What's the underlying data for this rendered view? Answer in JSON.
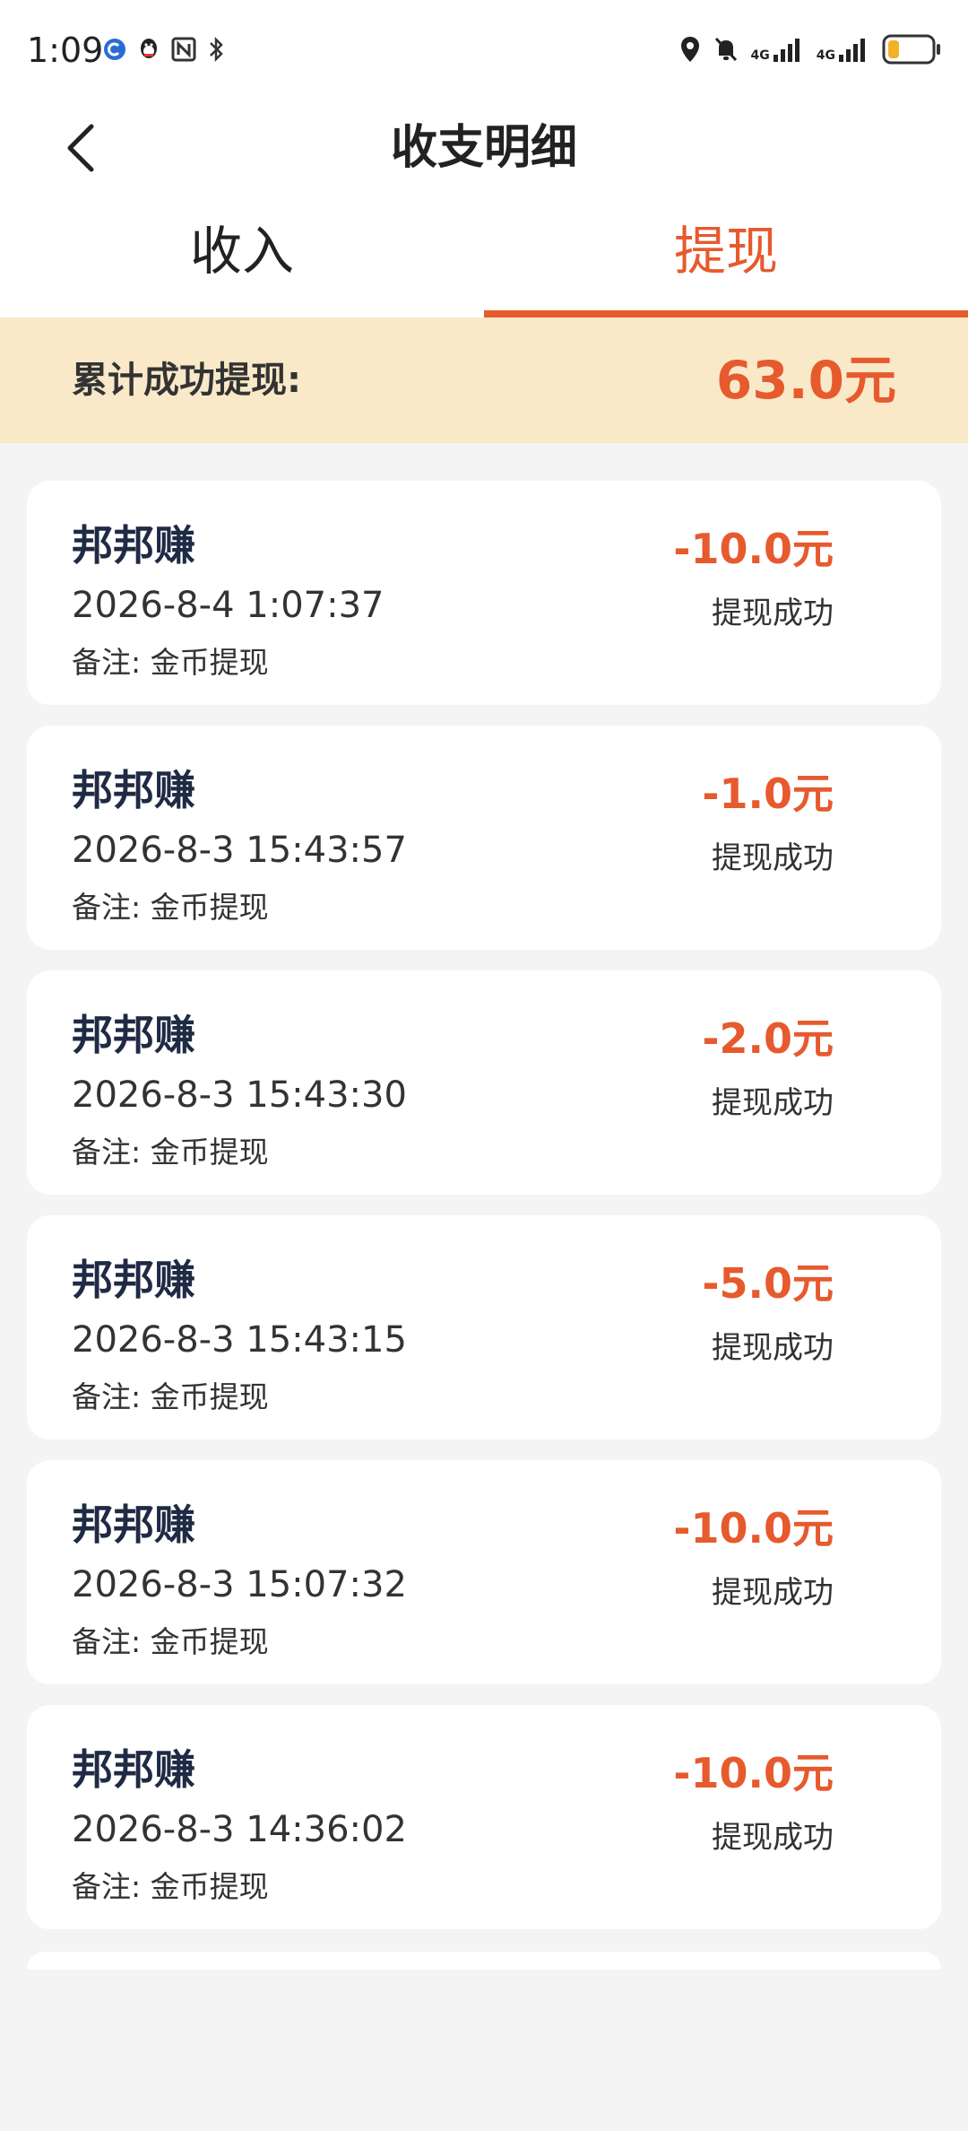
{
  "status_bar": {
    "time": "1:09",
    "left_icons": [
      "app-notification-icon",
      "qq-icon",
      "nfc-icon",
      "bluetooth-icon"
    ],
    "right_icons": [
      "location-icon",
      "mute-bell-icon",
      "signal-4g-icon",
      "signal-4g-icon",
      "battery-low-icon"
    ],
    "network_label_1": "4G",
    "network_label_2": "4G"
  },
  "header": {
    "title": "收支明细"
  },
  "tabs": [
    {
      "label": "收入",
      "active": false
    },
    {
      "label": "提现",
      "active": true
    }
  ],
  "summary": {
    "label": "累计成功提现:",
    "value": "63.0元"
  },
  "records": [
    {
      "title": "邦邦赚",
      "time": "2026-8-4 1:07:37",
      "note": "备注: 金币提现",
      "amount": "-10.0元",
      "status": "提现成功"
    },
    {
      "title": "邦邦赚",
      "time": "2026-8-3 15:43:57",
      "note": "备注: 金币提现",
      "amount": "-1.0元",
      "status": "提现成功"
    },
    {
      "title": "邦邦赚",
      "time": "2026-8-3 15:43:30",
      "note": "备注: 金币提现",
      "amount": "-2.0元",
      "status": "提现成功"
    },
    {
      "title": "邦邦赚",
      "time": "2026-8-3 15:43:15",
      "note": "备注: 金币提现",
      "amount": "-5.0元",
      "status": "提现成功"
    },
    {
      "title": "邦邦赚",
      "time": "2026-8-3 15:07:32",
      "note": "备注: 金币提现",
      "amount": "-10.0元",
      "status": "提现成功"
    },
    {
      "title": "邦邦赚",
      "time": "2026-8-3 14:36:02",
      "note": "备注: 金币提现",
      "amount": "-10.0元",
      "status": "提现成功"
    }
  ],
  "colors": {
    "accent": "#e65a2e",
    "summary_bg": "#f9e9c9",
    "title_text": "#1f2a44"
  }
}
